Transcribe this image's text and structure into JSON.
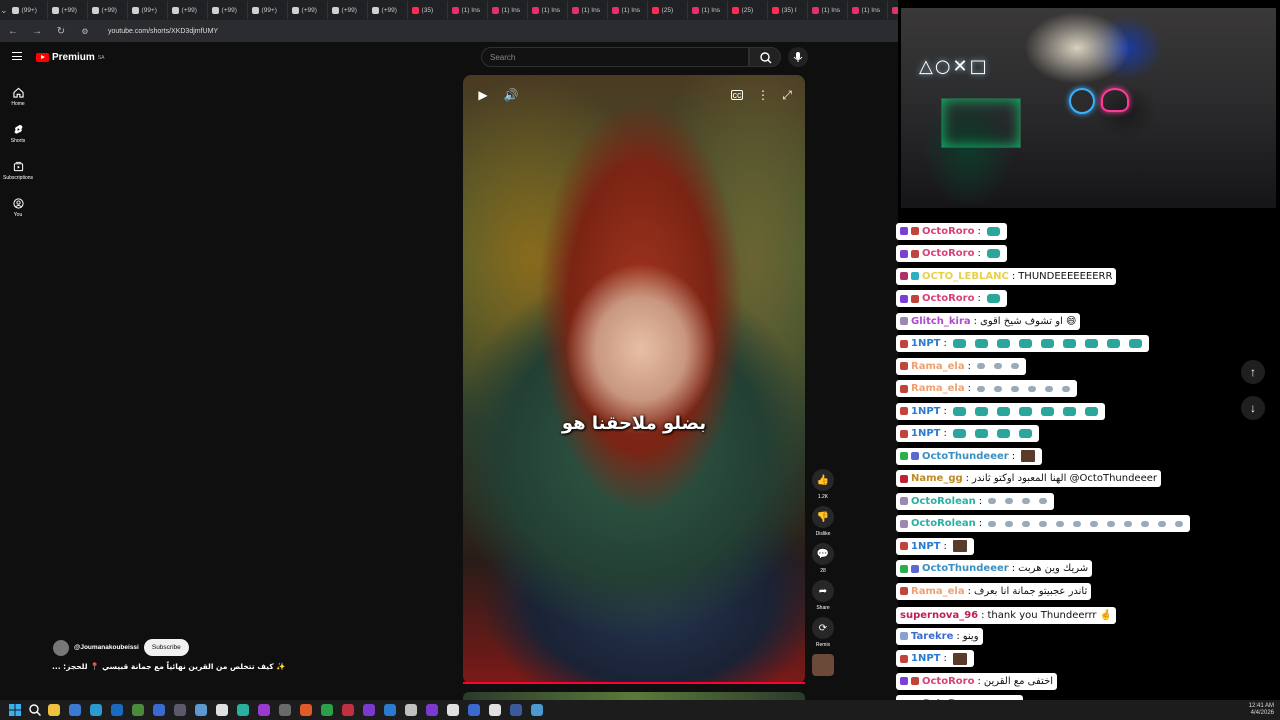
{
  "browser": {
    "tabs": [
      {
        "label": "(99+)",
        "color": "#d0d0d0"
      },
      {
        "label": "(+99)",
        "color": "#d0d0d0"
      },
      {
        "label": "(+99)",
        "color": "#d0d0d0"
      },
      {
        "label": "(99+)",
        "color": "#d0d0d0"
      },
      {
        "label": "(+99)",
        "color": "#d0d0d0"
      },
      {
        "label": "(+99)",
        "color": "#d0d0d0"
      },
      {
        "label": "(99+)",
        "color": "#d0d0d0"
      },
      {
        "label": "(+99)",
        "color": "#d0d0d0"
      },
      {
        "label": "(+99)",
        "color": "#d0d0d0"
      },
      {
        "label": "(+99)",
        "color": "#d0d0d0"
      },
      {
        "label": "(35)",
        "color": "#ff2d55"
      },
      {
        "label": "(1) Ins",
        "color": "#e1306c"
      },
      {
        "label": "(1) Ins",
        "color": "#e1306c"
      },
      {
        "label": "(1) Ins",
        "color": "#e1306c"
      },
      {
        "label": "(1) Ins",
        "color": "#e1306c"
      },
      {
        "label": "(1) Ins",
        "color": "#e1306c"
      },
      {
        "label": "(25)",
        "color": "#ff2d55"
      },
      {
        "label": "(1) Ins",
        "color": "#e1306c"
      },
      {
        "label": "(25)",
        "color": "#ff2d55"
      },
      {
        "label": "(35) I",
        "color": "#ff2d55"
      },
      {
        "label": "(1) Ins",
        "color": "#e1306c"
      },
      {
        "label": "(1) Ins",
        "color": "#e1306c"
      },
      {
        "label": "(1) Ins",
        "color": "#e1306c"
      }
    ],
    "url": "youtube.com/shorts/XKD3djmfUMY"
  },
  "youtube": {
    "logo_text": "Premium",
    "logo_region": "SA",
    "search_placeholder": "Search",
    "sidebar": [
      {
        "label": "Home",
        "icon": "home-icon"
      },
      {
        "label": "Shorts",
        "icon": "shorts-icon"
      },
      {
        "label": "Subscriptions",
        "icon": "subscriptions-icon"
      },
      {
        "label": "You",
        "icon": "you-icon"
      }
    ],
    "caption": "بضلو ملاحقنا هو",
    "actions": {
      "like_count": "1.2K",
      "dislike_label": "Dislike",
      "comments_count": "28",
      "share_label": "Share",
      "remix_label": "Remix"
    },
    "channel": {
      "handle": "@Joumanakoubeissi",
      "subscribe_label": "Subscribe"
    },
    "video_title": "✨ كيف تتخلص من القرين نهائياً مع جمانة قبيسي 📍 للحجز: ..."
  },
  "chat": {
    "messages": [
      {
        "user": "OctoRoro",
        "color": "#d9407a",
        "badges": [
          "#7b3fd4",
          "#c1443c"
        ],
        "text": "",
        "emotes": 1,
        "emote_type": "teal"
      },
      {
        "user": "OctoRoro",
        "color": "#d9407a",
        "badges": [
          "#7b3fd4",
          "#c1443c"
        ],
        "text": "",
        "emotes": 1,
        "emote_type": "teal"
      },
      {
        "user": "OCTO_LEBLANC",
        "color": "#e8d04a",
        "badges": [
          "#b0306a",
          "#2ab0c0"
        ],
        "text": "THUNDEEEEEEERR",
        "emotes": 0
      },
      {
        "user": "OctoRoro",
        "color": "#d9407a",
        "badges": [
          "#7b3fd4",
          "#c1443c"
        ],
        "text": "",
        "emotes": 1,
        "emote_type": "teal"
      },
      {
        "user": "Glitch_kira",
        "color": "#b04ad0",
        "badges": [
          "#9b8ab0"
        ],
        "text": "او تشوف شيخ اقوى 😄",
        "emotes": 0
      },
      {
        "user": "1NPT",
        "color": "#2a7ad0",
        "badges": [
          "#c1443c"
        ],
        "text": "",
        "emotes": 9,
        "emote_type": "teal"
      },
      {
        "user": "Rama_ela",
        "color": "#f0a070",
        "badges": [
          "#c1443c"
        ],
        "text": "",
        "emotes": 3,
        "emote_type": "small"
      },
      {
        "user": "Rama_ela",
        "color": "#f0a070",
        "badges": [
          "#c1443c"
        ],
        "text": "",
        "emotes": 6,
        "emote_type": "small"
      },
      {
        "user": "1NPT",
        "color": "#2a7ad0",
        "badges": [
          "#c1443c"
        ],
        "text": "",
        "emotes": 7,
        "emote_type": "teal"
      },
      {
        "user": "1NPT",
        "color": "#2a7ad0",
        "badges": [
          "#c1443c"
        ],
        "text": "",
        "emotes": 4,
        "emote_type": "teal"
      },
      {
        "user": "OctoThundeeer",
        "color": "#3a90c0",
        "badges": [
          "#2ab04a",
          "#5a6ad0"
        ],
        "text": "",
        "emotes": 1,
        "emote_type": "img"
      },
      {
        "user": "Name_gg",
        "color": "#c08a20",
        "badges": [
          "#c02030"
        ],
        "text": "الهنا المعبود اوكتو ثاندر @OctoThundeeer",
        "emotes": 0
      },
      {
        "user": "OctoRolean",
        "color": "#2ab0a0",
        "badges": [
          "#9b8ab0"
        ],
        "text": "",
        "emotes": 4,
        "emote_type": "small"
      },
      {
        "user": "OctoRolean",
        "color": "#2ab0a0",
        "badges": [
          "#9b8ab0"
        ],
        "text": "",
        "emotes": 12,
        "emote_type": "small"
      },
      {
        "user": "1NPT",
        "color": "#2a7ad0",
        "badges": [
          "#c1443c"
        ],
        "text": "",
        "emotes": 1,
        "emote_type": "img"
      },
      {
        "user": "OctoThundeeer",
        "color": "#3a90c0",
        "badges": [
          "#2ab04a",
          "#5a6ad0"
        ],
        "text": "شريك وين هربت",
        "emotes": 0
      },
      {
        "user": "Rama_ela",
        "color": "#f0a070",
        "badges": [
          "#c1443c"
        ],
        "text": "ثاندر عجبيتو جمانة انا بعرف",
        "emotes": 0
      },
      {
        "user": "supernova_96",
        "color": "#c02050",
        "badges": [],
        "text": "thank you Thundeerrr 🤞",
        "emotes": 0
      },
      {
        "user": "Tarekre",
        "color": "#3a6ad0",
        "badges": [
          "#8aa0d0"
        ],
        "text": "وينو",
        "emotes": 0
      },
      {
        "user": "1NPT",
        "color": "#2a7ad0",
        "badges": [
          "#c1443c"
        ],
        "text": "",
        "emotes": 1,
        "emote_type": "img"
      },
      {
        "user": "OctoRoro",
        "color": "#d9407a",
        "badges": [
          "#7b3fd4",
          "#c1443c"
        ],
        "text": "اختفى مع القرين",
        "emotes": 0
      },
      {
        "user": "OctoRoro",
        "color": "#d9407a",
        "badges": [
          "#7b3fd4",
          "#c1443c"
        ],
        "text": "تعي تعي",
        "emotes": 0
      }
    ]
  },
  "taskbar": {
    "time": "12:41 AM",
    "date": "4/4/2026",
    "icons": [
      "#f0c040",
      "#3a7ad0",
      "#2a9ad0",
      "#1a6ac0",
      "#4a8a3a",
      "#3a6ad0",
      "#5a5a6a",
      "#5a9ad0",
      "#e0e0e0",
      "#2ab0a0",
      "#9a3ad0",
      "#6a6a6a",
      "#e05a2a",
      "#2aa04a",
      "#c03040",
      "#7a3ad0",
      "#2a7ad0",
      "#c0c0c0",
      "#7a3ad0",
      "#e0e0e0",
      "#3a6ad0",
      "#e0e0e0",
      "#3a5a9a",
      "#4a9ad0"
    ]
  }
}
